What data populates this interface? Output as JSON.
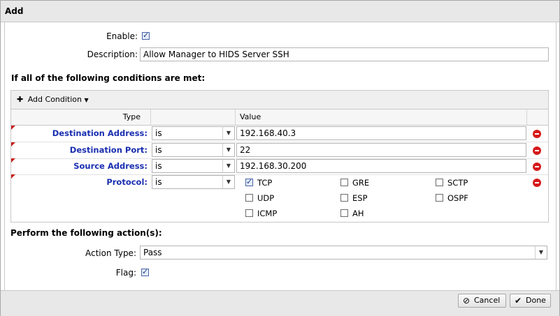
{
  "window": {
    "title": "Add"
  },
  "enable": {
    "label": "Enable:",
    "checked": true
  },
  "description": {
    "label": "Description:",
    "value": "Allow Manager to HIDS Server SSH"
  },
  "conditions": {
    "heading": "If all of the following conditions are met:",
    "add_condition_label": "Add Condition",
    "columns": {
      "type": "Type",
      "value": "Value"
    },
    "rows": [
      {
        "type": "Destination Address:",
        "operator": "is",
        "value": "192.168.40.3"
      },
      {
        "type": "Destination Port:",
        "operator": "is",
        "value": "22"
      },
      {
        "type": "Source Address:",
        "operator": "is",
        "value": "192.168.30.200"
      },
      {
        "type": "Protocol:",
        "operator": "is"
      }
    ],
    "protocols": [
      {
        "label": "TCP",
        "checked": true
      },
      {
        "label": "GRE",
        "checked": false
      },
      {
        "label": "SCTP",
        "checked": false
      },
      {
        "label": "UDP",
        "checked": false
      },
      {
        "label": "ESP",
        "checked": false
      },
      {
        "label": "OSPF",
        "checked": false
      },
      {
        "label": "ICMP",
        "checked": false
      },
      {
        "label": "AH",
        "checked": false
      }
    ]
  },
  "actions": {
    "heading": "Perform the following action(s):",
    "action_type_label": "Action Type:",
    "action_type_value": "Pass",
    "flag_label": "Flag:",
    "flag_checked": true
  },
  "buttons": {
    "cancel": "Cancel",
    "done": "Done"
  },
  "colors": {
    "field_label": "#1a2fb0",
    "remove": "#d61a1a",
    "dirty_marker": "#c81e1e"
  },
  "icons": {
    "add": "plus-icon",
    "cancel": "cancel-circle-icon",
    "done": "checkmark-icon",
    "remove": "remove-icon"
  }
}
